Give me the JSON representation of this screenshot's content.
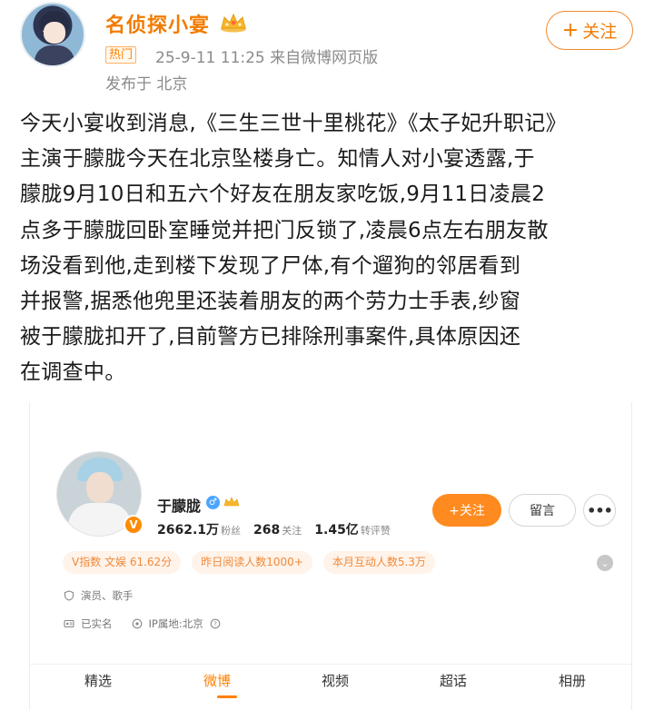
{
  "post": {
    "author": "名侦探小宴",
    "hot_badge": "热门",
    "meta": "25-9-11 11:25  来自微博网页版",
    "location": "发布于 北京",
    "follow_label": "关注",
    "text_lines": [
      "今天小宴收到消息,《三生三世十里桃花》《太子妃升职记》",
      "主演于朦胧今天在北京坠楼身亡。知情人对小宴透露,于",
      "朦胧9月10日和五六个好友在朋友家吃饭,9月11日凌晨2",
      "点多于朦胧回卧室睡觉并把门反锁了,凌晨6点左右朋友散",
      "场没看到他,走到楼下发现了尸体,有个遛狗的邻居看到",
      "并报警,据悉他兜里还装着朋友的两个劳力士手表,纱窗",
      "被于朦胧扣开了,目前警方已排除刑事案件,具体原因还",
      "在调查中。"
    ]
  },
  "profile": {
    "name": "于朦胧",
    "verified_symbol": "V",
    "followers_value": "2662.1万",
    "followers_label": "粉丝",
    "following_value": "268",
    "following_label": "关注",
    "reposts_value": "1.45亿",
    "reposts_label": "转评赞",
    "follow_button": "+关注",
    "message_button": "留言",
    "more_button": "•••",
    "tags": [
      "V指数 文娱 61.62分",
      "昨日阅读人数1000+",
      "本月互动人数5.3万"
    ],
    "occupation": "演员、歌手",
    "real_name": "已实名",
    "ip_location": "IP属地:北京",
    "tabs": [
      "精选",
      "微博",
      "视频",
      "超话",
      "相册"
    ],
    "active_tab": "微博"
  },
  "colors": {
    "accent": "#ff8200",
    "author_name": "#f27b00",
    "tag_bg": "#fff3ea"
  },
  "icons": [
    "crown-icon",
    "verified-badge-icon",
    "gender-male-icon",
    "shield-icon",
    "id-card-icon",
    "location-icon",
    "help-icon",
    "chevron-down-icon"
  ]
}
